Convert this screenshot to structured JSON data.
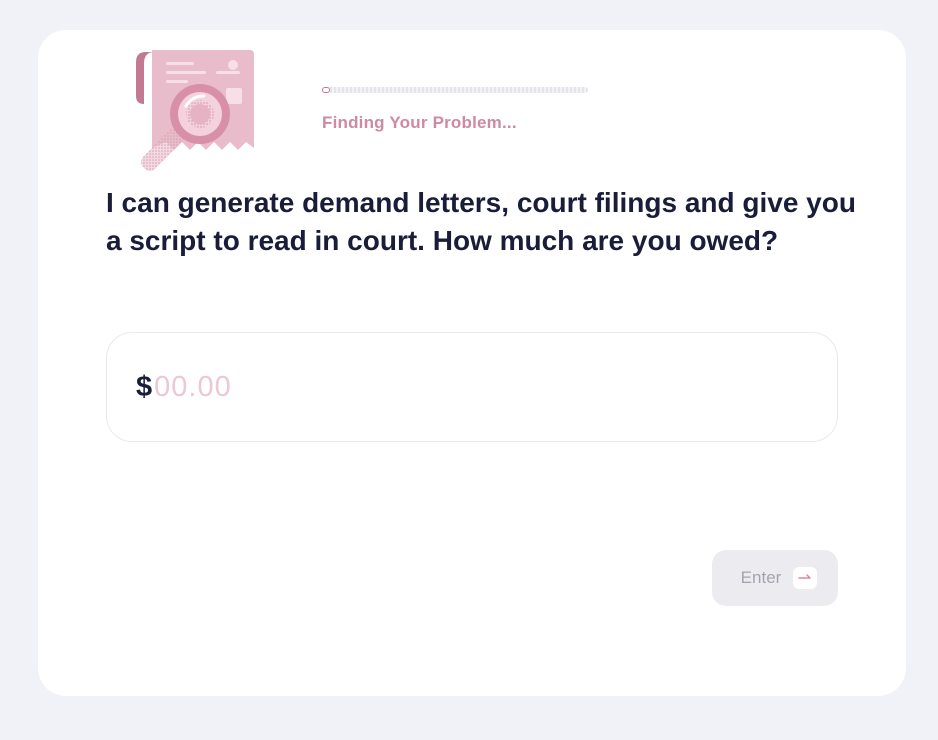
{
  "progress": {
    "status_text": "Finding Your Problem...",
    "percent": 3
  },
  "question": {
    "text": "I can generate demand letters, court filings and give you a script to read in court. How much are you owed?"
  },
  "amount": {
    "currency_symbol": "$",
    "placeholder": "00.00",
    "value": ""
  },
  "enter_button": {
    "label": "Enter",
    "icon": "arrow-right-icon"
  },
  "colors": {
    "background": "#f0f2f7",
    "card": "#ffffff",
    "heading": "#191d3a",
    "accent_pink": "#cd8aa2",
    "placeholder": "#ecc8d4",
    "button_bg": "#ecebf0"
  },
  "illustration": {
    "icon": "document-magnifier-icon"
  }
}
